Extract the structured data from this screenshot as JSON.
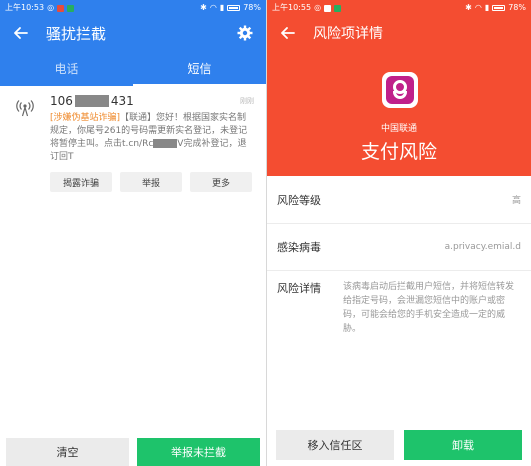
{
  "left": {
    "statusbar": {
      "time": "上午10:53",
      "battery": "78%"
    },
    "title": "骚扰拦截",
    "tabs": [
      {
        "label": "电话",
        "active": false
      },
      {
        "label": "短信",
        "active": true
      }
    ],
    "message": {
      "number_prefix": "106",
      "number_suffix": "431",
      "time": "刚刚",
      "tag": "[涉嫌伪基站诈骗]",
      "text_part1": "【联通】您好！根据国家实名制规定，你尾号261的号码需更新实名登记，未登记将暂停主叫。点击t.cn/Rc",
      "text_part2": "V完成补登记，退订回T"
    },
    "actions": [
      "揭露诈骗",
      "举报",
      "更多"
    ],
    "buttons": {
      "clear": "清空",
      "report": "举报未拦截"
    }
  },
  "right": {
    "statusbar": {
      "time": "上午10:55",
      "battery": "78%"
    },
    "title": "风险项详情",
    "app_name": "中国联通",
    "risk_type": "支付风险",
    "rows": {
      "level_key": "风险等级",
      "level_value": "高",
      "virus_key": "感染病毒",
      "virus_value": "a.privacy.emial.d",
      "detail_key": "风险详情",
      "detail_value": "该病毒启动后拦截用户短信，并将短信转发给指定号码，会泄漏您短信中的账户或密码，可能会给您的手机安全造成一定的威胁。"
    },
    "buttons": {
      "trust": "移入信任区",
      "uninstall": "卸载"
    }
  },
  "colors": {
    "blue_header": "#2f80ed",
    "red_header": "#f44d31",
    "green_button": "#1ec36b",
    "warning_tag": "#ef8a2c"
  }
}
